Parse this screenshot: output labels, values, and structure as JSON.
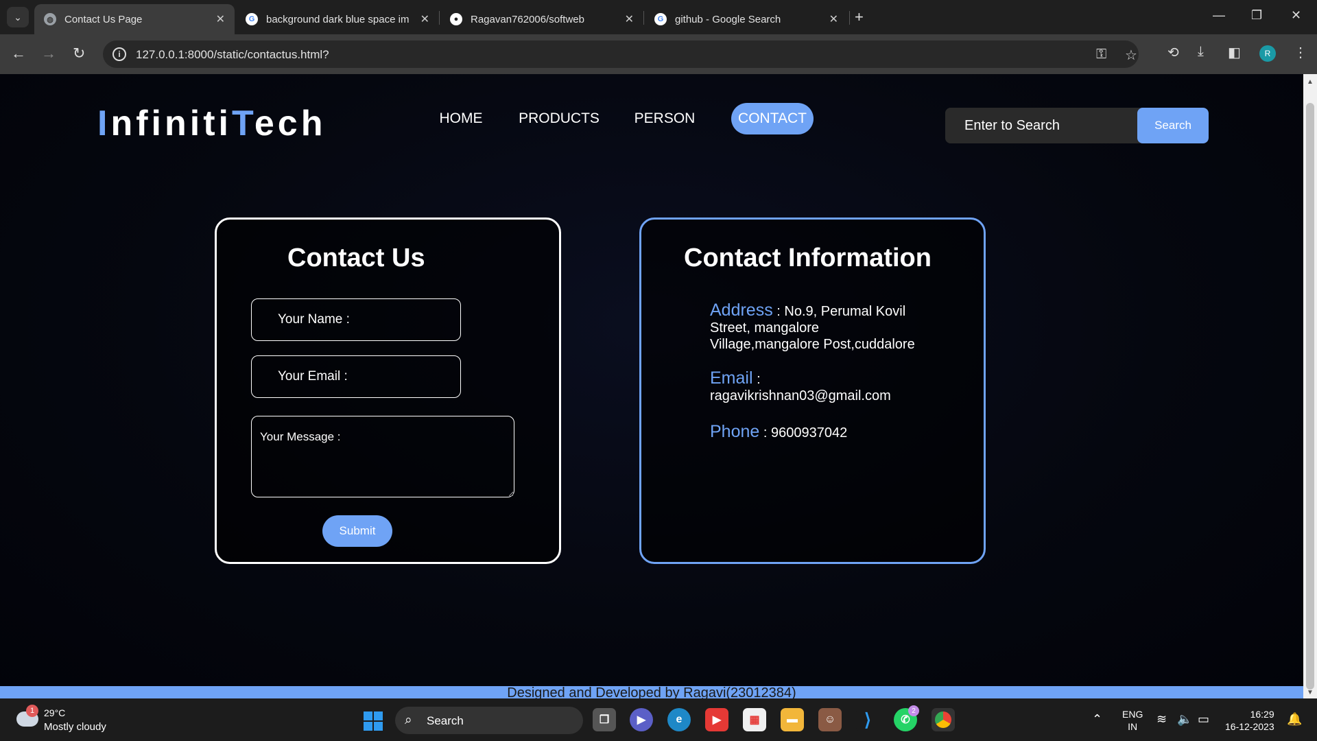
{
  "browser": {
    "tabs": [
      {
        "title": "Contact Us Page"
      },
      {
        "title": "background dark blue space im"
      },
      {
        "title": "Ragavan762006/softweb"
      },
      {
        "title": "github - Google Search"
      }
    ],
    "url": "127.0.0.1:8000/static/contactus.html?",
    "profile_initial": "R"
  },
  "page": {
    "logo": {
      "first_accent": "I",
      "part1": "nfiniti",
      "second_accent": "T",
      "part2": "ech"
    },
    "nav": {
      "home": "HOME",
      "products": "PRODUCTS",
      "person": "PERSON",
      "contact": "CONTACT"
    },
    "search": {
      "placeholder": "Enter to Search",
      "button": "Search"
    },
    "form": {
      "title": "Contact Us",
      "name_placeholder": "Your Name :",
      "email_placeholder": "Your Email :",
      "message_placeholder": "Your Message :",
      "submit": "Submit"
    },
    "info": {
      "title": "Contact Information",
      "address_label": "Address",
      "address_value": ": No.9, Perumal Kovil Street, mangalore Village,mangalore Post,cuddalore",
      "email_label": "Email",
      "email_value": ": ragavikrishnan03@gmail.com",
      "phone_label": "Phone",
      "phone_value": ": 9600937042"
    },
    "footer": "Designed and Developed by Ragavi(23012384)"
  },
  "taskbar": {
    "weather_temp": "29°C",
    "weather_desc": "Mostly cloudy",
    "weather_badge": "1",
    "search_label": "Search",
    "whatsapp_badge": "2",
    "language": "ENG",
    "region": "IN",
    "time": "16:29",
    "date": "16-12-2023"
  },
  "colors": {
    "accent": "#6fa3f5",
    "background": "#05070f"
  }
}
